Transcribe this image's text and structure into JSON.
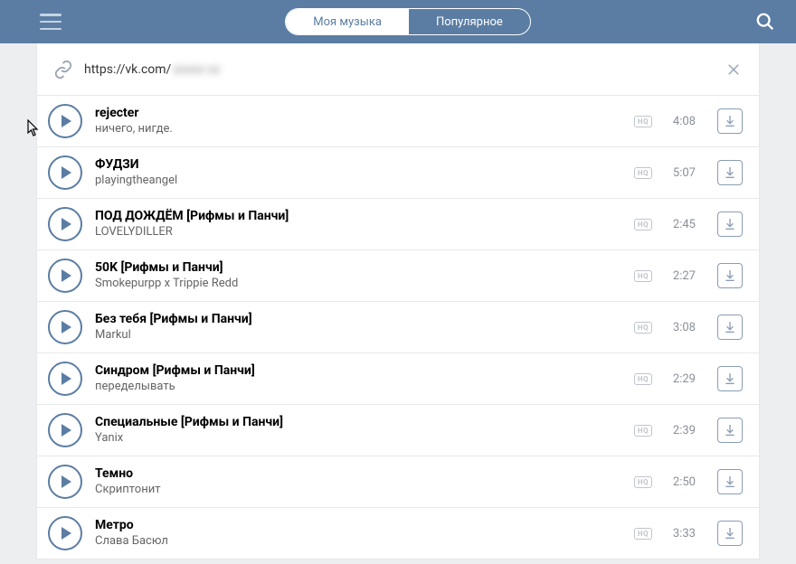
{
  "tabs": {
    "my_music": "Моя музыка",
    "popular": "Популярное"
  },
  "url": {
    "visible": "https://vk.com/",
    "blurred": "xxxxx xx"
  },
  "hq_label": "HQ",
  "tracks": [
    {
      "title": "rejecter",
      "artist": "ничего, нигде.",
      "duration": "4:08"
    },
    {
      "title": "ФУДЗИ",
      "artist": "playingtheangel",
      "duration": "5:07"
    },
    {
      "title": "ПОД ДОЖДЁМ [Рифмы и Панчи]",
      "artist": "LOVELYDILLER",
      "duration": "2:45"
    },
    {
      "title": "50K [Рифмы и Панчи]",
      "artist": "Smokepurpp x Trippie Redd",
      "duration": "2:27"
    },
    {
      "title": "Без тебя [Рифмы и Панчи]",
      "artist": "Markul",
      "duration": "3:08"
    },
    {
      "title": "Синдром [Рифмы и Панчи]",
      "artist": "переделывать",
      "duration": "2:29"
    },
    {
      "title": "Специальные [Рифмы и Панчи]",
      "artist": "Yanix",
      "duration": "2:39"
    },
    {
      "title": "Темно",
      "artist": "Скриптонит",
      "duration": "2:50"
    },
    {
      "title": "Метро",
      "artist": "Слава Басюл",
      "duration": "3:33"
    }
  ]
}
